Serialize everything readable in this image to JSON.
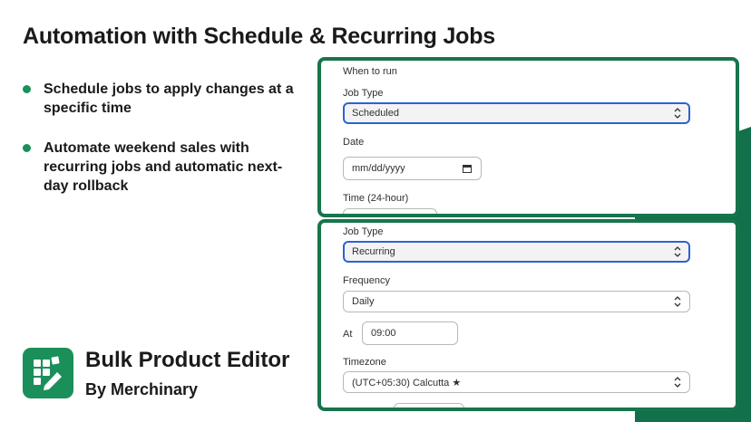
{
  "headline": "Automation with Schedule & Recurring Jobs",
  "bullets": [
    "Schedule jobs to apply changes at a specific time",
    "Automate weekend sales with recurring jobs and automatic next-day rollback"
  ],
  "brand": {
    "name": "Bulk Product Editor",
    "by": "By Merchinary",
    "logo_icon": "grid-pencil-icon"
  },
  "colors": {
    "brand_green": "#1b8f5a",
    "card_border": "#17744b",
    "focus_blue": "#2a63d4"
  },
  "schedule_card": {
    "section_title": "When to run",
    "job_type_label": "Job Type",
    "job_type_value": "Scheduled",
    "date_label": "Date",
    "date_placeholder": "mm/dd/yyyy",
    "time_label": "Time (24-hour)"
  },
  "recurring_card": {
    "job_type_label": "Job Type",
    "job_type_value": "Recurring",
    "frequency_label": "Frequency",
    "frequency_value": "Daily",
    "at_label": "At",
    "at_value": "09:00",
    "timezone_label": "Timezone",
    "timezone_value": "(UTC+05:30) Calcutta ★"
  }
}
